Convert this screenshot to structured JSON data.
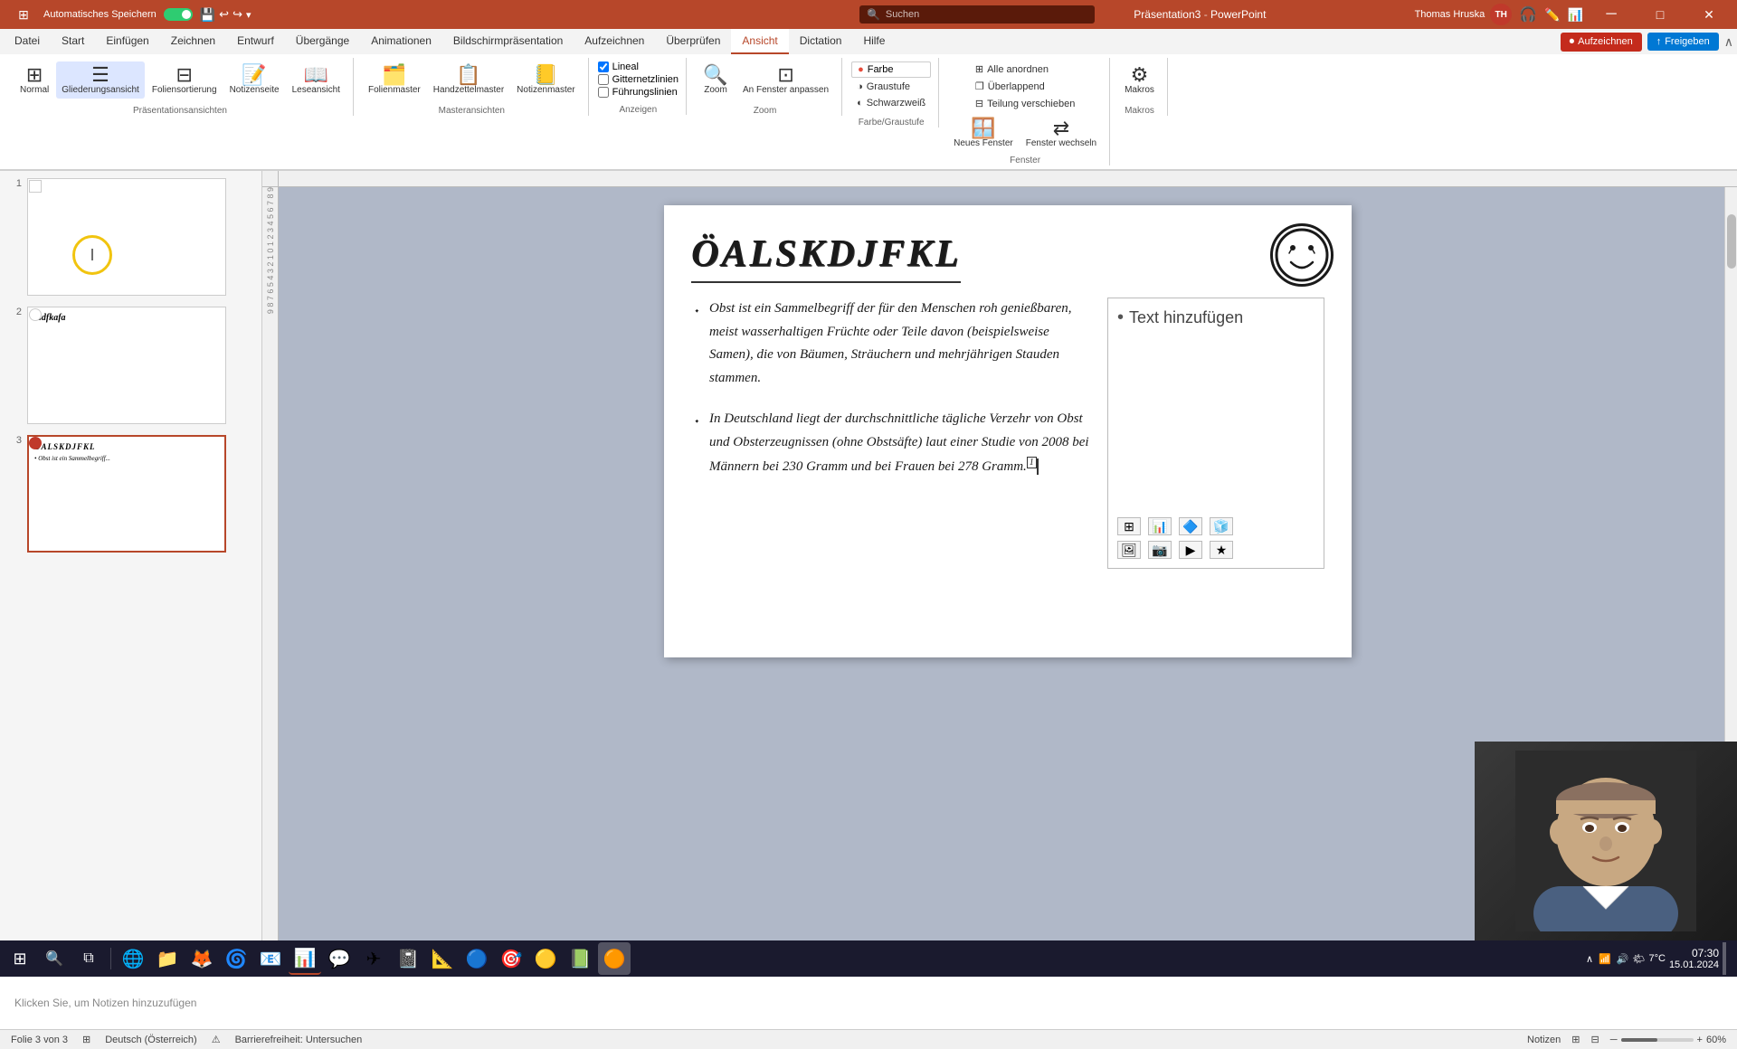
{
  "titlebar": {
    "autosave_label": "Automatisches Speichern",
    "file_name": "Präsentation3",
    "app_name": "PowerPoint",
    "search_placeholder": "Suchen",
    "user_name": "Thomas Hruska",
    "user_initials": "TH"
  },
  "ribbon": {
    "tabs": [
      "Datei",
      "Start",
      "Einfügen",
      "Zeichnen",
      "Entwurf",
      "Übergänge",
      "Animationen",
      "Bildschirmpräsentation",
      "Aufzeichnen",
      "Überprüfen",
      "Ansicht",
      "Dictation",
      "Hilfe"
    ],
    "active_tab": "Ansicht",
    "groups": {
      "prasentationsansichten": {
        "label": "Präsentationsansichten",
        "buttons": [
          "Normal",
          "Gliederungsansicht",
          "Foliensortierung",
          "Notizenseite",
          "Leseansicht"
        ]
      },
      "masteransichten": {
        "label": "Masteransichten",
        "buttons": [
          "Folienmaster",
          "Handzettelmaster",
          "Notizenmaster"
        ]
      },
      "anzeigen": {
        "label": "Anzeigen",
        "checkboxes": [
          "Lineal",
          "Gitternetzlinien",
          "Führungslinien"
        ]
      },
      "zoom_group": {
        "label": "Zoom",
        "buttons": [
          "Zoom",
          "An Fenster anpassen"
        ]
      },
      "farbe": {
        "label": "Farbe/Graustufe",
        "buttons": [
          "Farbe",
          "Graustufe",
          "Schwarzweiß"
        ]
      },
      "fenster": {
        "label": "Fenster",
        "buttons": [
          "Alle anordnen",
          "Überlappend",
          "Teilung verschieben",
          "Neues Fenster",
          "Fenster wechseln"
        ]
      },
      "makros": {
        "label": "Makros",
        "buttons": [
          "Makros"
        ]
      }
    },
    "record_btn": "Aufzeichnen",
    "share_btn": "Freigeben"
  },
  "slides": [
    {
      "num": "1",
      "selected": false,
      "has_content": false
    },
    {
      "num": "2",
      "selected": false,
      "has_content": true,
      "label": "asdfkafa"
    },
    {
      "num": "3",
      "selected": true,
      "has_content": true,
      "label": "öalskdjfkl"
    }
  ],
  "slide": {
    "title": "ÖALSKDJFKL",
    "bullet1": "Obst ist ein Sammelbegriff der für den Menschen roh genießbaren, meist wasserhaltigen Früchte oder Teile davon (beispielsweise Samen), die von Bäumen, Sträuchern und mehrjährigen Stauden stammen.",
    "bullet2": "In Deutschland liegt der durchschnittliche tägliche Verzehr von Obst und Obsterzeugnissen (ohne Obstsäfte) laut einer Studie von 2008 bei Männern bei 230 Gramm und bei Frauen bei 278 Gramm.",
    "placeholder_text": "Text hinzufügen",
    "smiley": "☺"
  },
  "notes": {
    "placeholder": "Klicken Sie, um Notizen hinzuzufügen"
  },
  "statusbar": {
    "slide_info": "Folie 3 von 3",
    "language": "Deutsch (Österreich)",
    "accessibility": "Barrierefreiheit: Untersuchen",
    "notes_btn": "Notizen"
  },
  "video": {
    "visible": true
  },
  "taskbar": {
    "weather": "7°C",
    "time": "07:30",
    "date": "15.01.2024"
  }
}
